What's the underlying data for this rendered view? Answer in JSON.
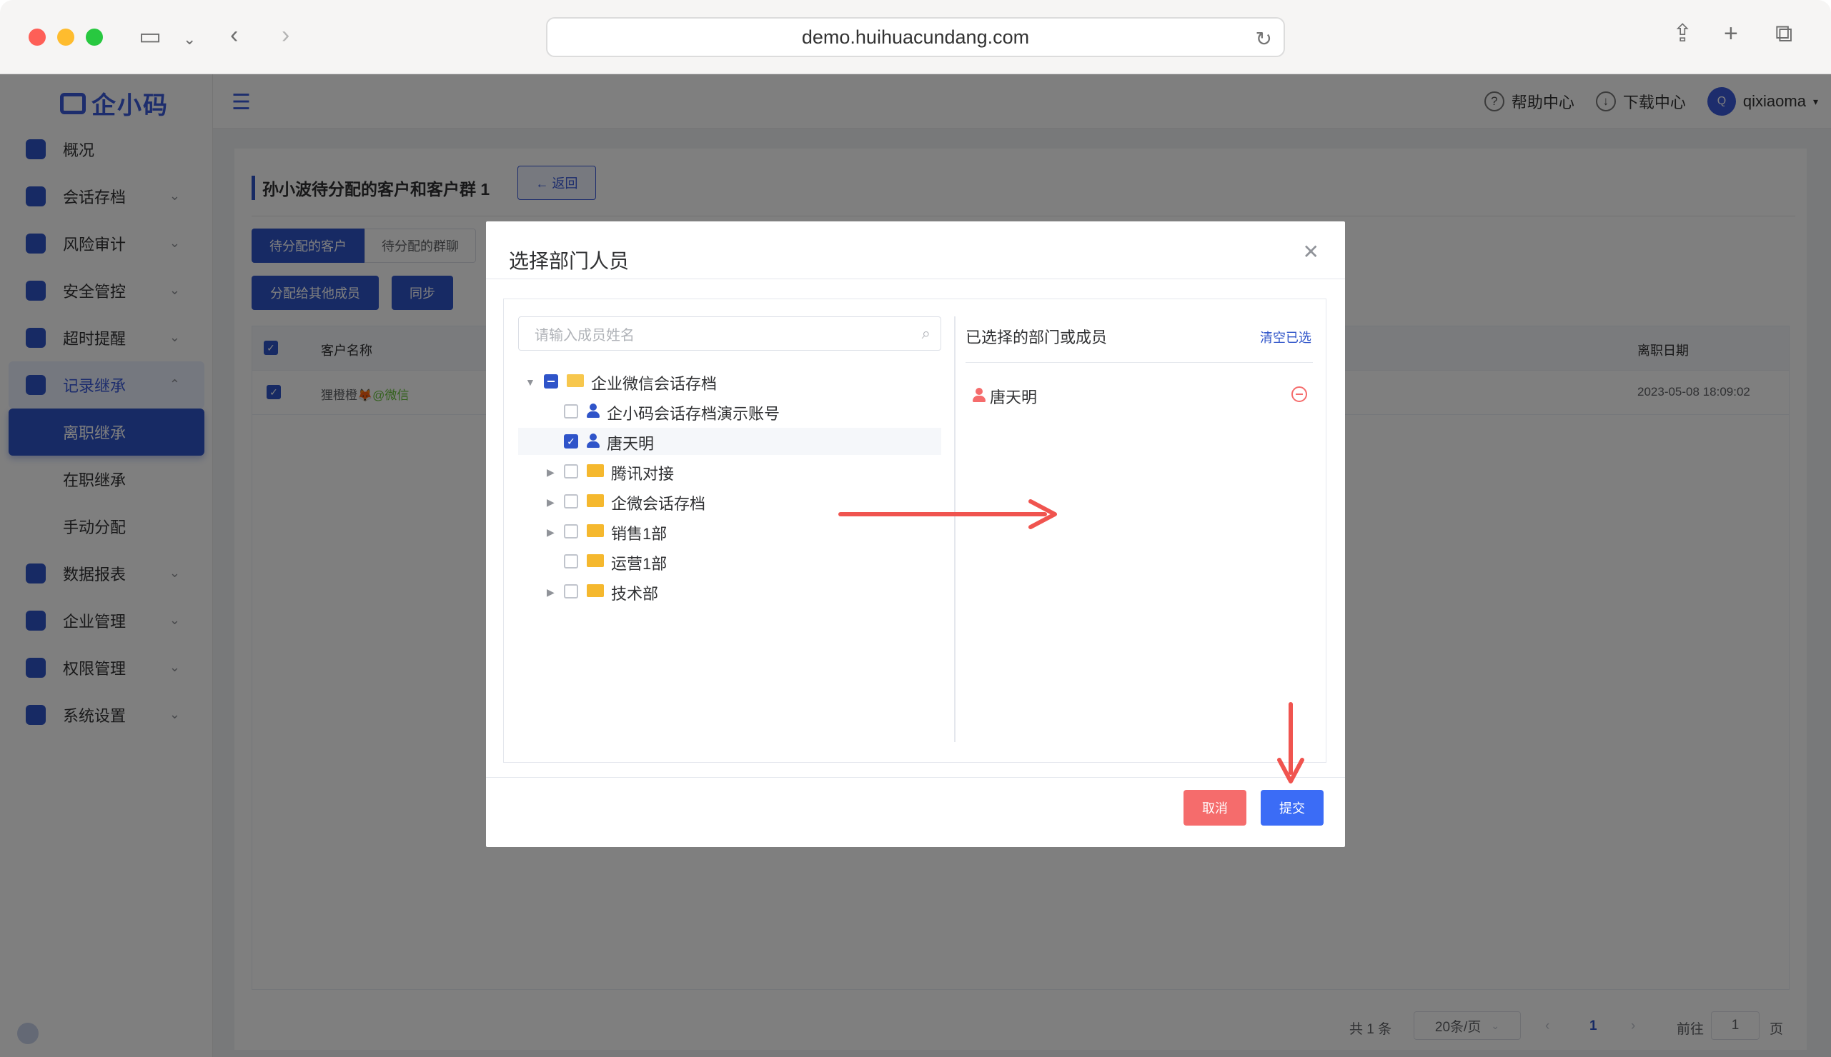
{
  "browser": {
    "url": "demo.huihuacundang.com"
  },
  "app": {
    "logo_text": "企小码",
    "topbar": {
      "help": "帮助中心",
      "download": "下载中心",
      "avatar_letter": "Q",
      "username": "qixiaoma"
    },
    "sidebar": {
      "items": [
        {
          "label": "概况",
          "has_children": false
        },
        {
          "label": "会话存档",
          "has_children": true
        },
        {
          "label": "风险审计",
          "has_children": true
        },
        {
          "label": "安全管控",
          "has_children": true
        },
        {
          "label": "超时提醒",
          "has_children": true
        },
        {
          "label": "记录继承",
          "has_children": true,
          "expanded": true
        },
        {
          "label": "数据报表",
          "has_children": true
        },
        {
          "label": "企业管理",
          "has_children": true
        },
        {
          "label": "权限管理",
          "has_children": true
        },
        {
          "label": "系统设置",
          "has_children": true
        }
      ],
      "sub_items": [
        {
          "label": "离职继承",
          "active": true
        },
        {
          "label": "在职继承",
          "active": false
        },
        {
          "label": "手动分配",
          "active": false
        }
      ]
    },
    "page": {
      "title": "孙小波待分配的客户和客户群 1",
      "back_label": "← 返回",
      "tabs": [
        "待分配的客户",
        "待分配的群聊"
      ],
      "actions": [
        "分配给其他成员",
        "同步"
      ],
      "table": {
        "headers": [
          "客户名称",
          "离职日期"
        ],
        "rows": [
          {
            "name": "狸橙橙🦊",
            "tag": "@微信",
            "date": "2023-05-08 18:09:02"
          }
        ]
      },
      "pager": {
        "total": "共 1 条",
        "page_size": "20条/页",
        "current": "1",
        "goto_label": "前往",
        "goto_value": "1",
        "page_suffix": "页"
      }
    }
  },
  "modal": {
    "title": "选择部门人员",
    "search_placeholder": "请输入成员姓名",
    "tree": [
      {
        "label": "企业微信会话存档",
        "type": "folder",
        "level": 0,
        "state": "indeterminate",
        "expanded": true
      },
      {
        "label": "企小码会话存档演示账号",
        "type": "person",
        "level": 1,
        "state": "unchecked"
      },
      {
        "label": "唐天明",
        "type": "person",
        "level": 1,
        "state": "checked"
      },
      {
        "label": "腾讯对接",
        "type": "folder",
        "level": 1,
        "state": "unchecked",
        "expandable": true
      },
      {
        "label": "企微会话存档",
        "type": "folder",
        "level": 1,
        "state": "unchecked",
        "expandable": true
      },
      {
        "label": "销售1部",
        "type": "folder",
        "level": 1,
        "state": "unchecked",
        "expandable": true
      },
      {
        "label": "运营1部",
        "type": "folder",
        "level": 1,
        "state": "unchecked",
        "expandable": false
      },
      {
        "label": "技术部",
        "type": "folder",
        "level": 1,
        "state": "unchecked",
        "expandable": true
      }
    ],
    "selected_header": "已选择的部门或成员",
    "clear_label": "清空已选",
    "selected": [
      {
        "label": "唐天明"
      }
    ],
    "cancel_label": "取消",
    "submit_label": "提交"
  },
  "colors": {
    "primary": "#2f54c9",
    "danger": "#f56c6c",
    "annotation_arrow": "#f0544f"
  }
}
